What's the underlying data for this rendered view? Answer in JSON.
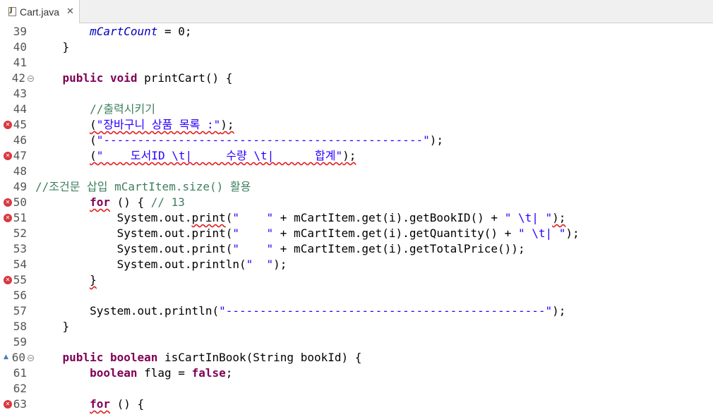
{
  "tab": {
    "title": "Cart.java",
    "close": "✕"
  },
  "lines": [
    {
      "num": "39",
      "fold": false,
      "error": false,
      "override": false,
      "indent": "        ",
      "segs": [
        {
          "t": "mCartCount",
          "c": "fld"
        },
        {
          "t": " = 0;",
          "c": ""
        }
      ]
    },
    {
      "num": "40",
      "fold": false,
      "error": false,
      "override": false,
      "indent": "    ",
      "segs": [
        {
          "t": "}",
          "c": ""
        }
      ]
    },
    {
      "num": "41",
      "fold": false,
      "error": false,
      "override": false,
      "indent": "",
      "segs": []
    },
    {
      "num": "42",
      "fold": true,
      "error": false,
      "override": false,
      "indent": "    ",
      "segs": [
        {
          "t": "public",
          "c": "kw"
        },
        {
          "t": " ",
          "c": ""
        },
        {
          "t": "void",
          "c": "kw"
        },
        {
          "t": " printCart() {",
          "c": ""
        }
      ]
    },
    {
      "num": "43",
      "fold": false,
      "error": false,
      "override": false,
      "indent": "",
      "segs": []
    },
    {
      "num": "44",
      "fold": false,
      "error": false,
      "override": false,
      "indent": "        ",
      "segs": [
        {
          "t": "//출력시키기",
          "c": "cmt"
        }
      ]
    },
    {
      "num": "45",
      "fold": false,
      "error": true,
      "override": false,
      "indent": "        ",
      "segs": [
        {
          "t": "(",
          "c": "err"
        },
        {
          "t": "\"장바구니 상품 목록 :\"",
          "c": "str err"
        },
        {
          "t": ");",
          "c": "err"
        }
      ]
    },
    {
      "num": "46",
      "fold": false,
      "error": false,
      "override": false,
      "indent": "        ",
      "segs": [
        {
          "t": "(",
          "c": ""
        },
        {
          "t": "\"-----------------------------------------------\"",
          "c": "str"
        },
        {
          "t": ");",
          "c": ""
        }
      ]
    },
    {
      "num": "47",
      "fold": false,
      "error": true,
      "override": false,
      "indent": "        ",
      "segs": [
        {
          "t": "(",
          "c": "err"
        },
        {
          "t": "\"    도서ID \\t|     수량 \\t|      합계\"",
          "c": "str err"
        },
        {
          "t": ");",
          "c": "err"
        }
      ]
    },
    {
      "num": "48",
      "fold": false,
      "error": false,
      "override": false,
      "indent": "",
      "segs": []
    },
    {
      "num": "49",
      "fold": false,
      "error": false,
      "override": false,
      "indent": "",
      "segs": [
        {
          "t": "//조건문 삽입 mCartItem.size() 활용",
          "c": "cmt"
        }
      ]
    },
    {
      "num": "50",
      "fold": false,
      "error": true,
      "override": false,
      "indent": "        ",
      "segs": [
        {
          "t": "for",
          "c": "kw err"
        },
        {
          "t": " () { ",
          "c": ""
        },
        {
          "t": "// 13",
          "c": "cmt"
        }
      ]
    },
    {
      "num": "51",
      "fold": false,
      "error": true,
      "override": false,
      "indent": "            ",
      "segs": [
        {
          "t": "System.out.",
          "c": ""
        },
        {
          "t": "print",
          "c": "err"
        },
        {
          "t": "(",
          "c": ""
        },
        {
          "t": "\"    \"",
          "c": "str"
        },
        {
          "t": " + mCartItem.get(i).getBookID() + ",
          "c": ""
        },
        {
          "t": "\" \\t| \"",
          "c": "str"
        },
        {
          "t": ");",
          "c": "err"
        }
      ]
    },
    {
      "num": "52",
      "fold": false,
      "error": false,
      "override": false,
      "indent": "            ",
      "segs": [
        {
          "t": "System.out.print(",
          "c": ""
        },
        {
          "t": "\"    \"",
          "c": "str"
        },
        {
          "t": " + mCartItem.get(i).getQuantity() + ",
          "c": ""
        },
        {
          "t": "\" \\t| \"",
          "c": "str"
        },
        {
          "t": ");",
          "c": ""
        }
      ]
    },
    {
      "num": "53",
      "fold": false,
      "error": false,
      "override": false,
      "indent": "            ",
      "segs": [
        {
          "t": "System.out.print(",
          "c": ""
        },
        {
          "t": "\"    \"",
          "c": "str"
        },
        {
          "t": " + mCartItem.get(i).getTotalPrice());",
          "c": ""
        }
      ]
    },
    {
      "num": "54",
      "fold": false,
      "error": false,
      "override": false,
      "indent": "            ",
      "segs": [
        {
          "t": "System.out.println(",
          "c": ""
        },
        {
          "t": "\"  \"",
          "c": "str"
        },
        {
          "t": ");",
          "c": ""
        }
      ]
    },
    {
      "num": "55",
      "fold": false,
      "error": true,
      "override": false,
      "indent": "        ",
      "segs": [
        {
          "t": "}",
          "c": "err"
        }
      ]
    },
    {
      "num": "56",
      "fold": false,
      "error": false,
      "override": false,
      "indent": "",
      "segs": []
    },
    {
      "num": "57",
      "fold": false,
      "error": false,
      "override": false,
      "indent": "        ",
      "segs": [
        {
          "t": "System.out.println(",
          "c": ""
        },
        {
          "t": "\"-----------------------------------------------\"",
          "c": "str"
        },
        {
          "t": ");",
          "c": ""
        }
      ]
    },
    {
      "num": "58",
      "fold": false,
      "error": false,
      "override": false,
      "indent": "    ",
      "segs": [
        {
          "t": "}",
          "c": ""
        }
      ]
    },
    {
      "num": "59",
      "fold": false,
      "error": false,
      "override": false,
      "indent": "",
      "segs": []
    },
    {
      "num": "60",
      "fold": true,
      "error": false,
      "override": true,
      "indent": "    ",
      "segs": [
        {
          "t": "public",
          "c": "kw"
        },
        {
          "t": " ",
          "c": ""
        },
        {
          "t": "boolean",
          "c": "kw"
        },
        {
          "t": " isCartInBook(String bookId) {",
          "c": ""
        }
      ]
    },
    {
      "num": "61",
      "fold": false,
      "error": false,
      "override": false,
      "indent": "        ",
      "segs": [
        {
          "t": "boolean",
          "c": "kw"
        },
        {
          "t": " flag = ",
          "c": ""
        },
        {
          "t": "false",
          "c": "kw"
        },
        {
          "t": ";",
          "c": ""
        }
      ]
    },
    {
      "num": "62",
      "fold": false,
      "error": false,
      "override": false,
      "indent": "",
      "segs": []
    },
    {
      "num": "63",
      "fold": false,
      "error": true,
      "override": false,
      "indent": "        ",
      "segs": [
        {
          "t": "for",
          "c": "kw err"
        },
        {
          "t": " () {",
          "c": ""
        }
      ]
    }
  ]
}
